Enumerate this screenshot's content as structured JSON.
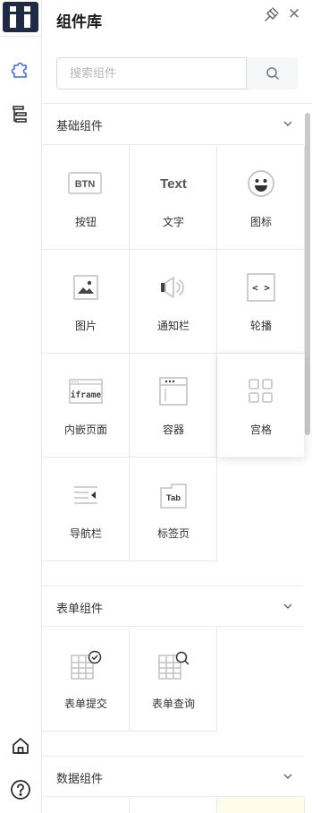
{
  "panel": {
    "title": "组件库"
  },
  "search": {
    "placeholder": "搜索组件"
  },
  "sections": [
    {
      "title": "基础组件",
      "items": [
        {
          "label": "按钮",
          "icon": "button-icon",
          "icon_text": "BTN"
        },
        {
          "label": "文字",
          "icon": "text-icon",
          "icon_text": "Text"
        },
        {
          "label": "图标",
          "icon": "smiley-icon"
        },
        {
          "label": "图片",
          "icon": "image-icon"
        },
        {
          "label": "通知栏",
          "icon": "speaker-icon"
        },
        {
          "label": "轮播",
          "icon": "carousel-icon",
          "icon_text": "< >"
        },
        {
          "label": "内嵌页面",
          "icon": "iframe-icon",
          "icon_text": "iframe"
        },
        {
          "label": "容器",
          "icon": "container-icon"
        },
        {
          "label": "宫格",
          "icon": "grid-icon"
        },
        {
          "label": "导航栏",
          "icon": "navbar-icon"
        },
        {
          "label": "标签页",
          "icon": "tab-icon",
          "icon_text": "Tab"
        }
      ]
    },
    {
      "title": "表单组件",
      "items": [
        {
          "label": "表单提交",
          "icon": "form-submit-icon"
        },
        {
          "label": "表单查询",
          "icon": "form-query-icon"
        }
      ]
    },
    {
      "title": "数据组件",
      "items": []
    }
  ],
  "colors": {
    "logo_bg": "#1d2c44",
    "rail_icon": "#3b6fd6",
    "icon_gray": "#b5b5b5",
    "highlight_tile": "#fffdea"
  }
}
